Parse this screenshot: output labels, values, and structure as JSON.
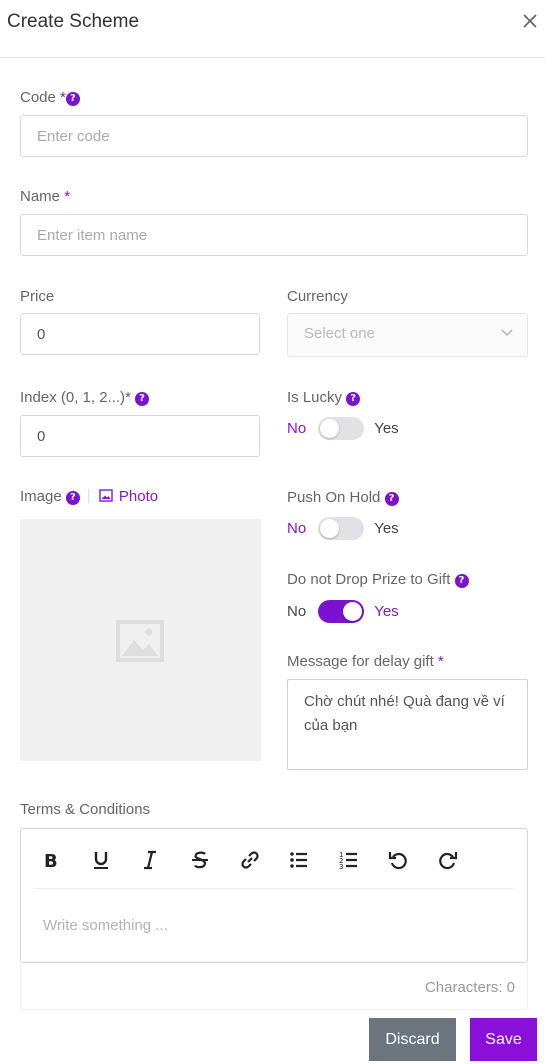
{
  "dialog": {
    "title": "Create Scheme"
  },
  "fields": {
    "code": {
      "label": "Code",
      "required": "*",
      "help": "?",
      "placeholder": "Enter code"
    },
    "name": {
      "label": "Name",
      "required": "*",
      "placeholder": "Enter item name"
    },
    "price": {
      "label": "Price",
      "value": "0"
    },
    "currency": {
      "label": "Currency",
      "placeholder": "Select one"
    },
    "index": {
      "label": "Index (0, 1, 2...)",
      "required": "*",
      "help": "?",
      "value": "0"
    },
    "is_lucky": {
      "label": "Is Lucky",
      "help": "?",
      "no": "No",
      "yes": "Yes",
      "on": false
    },
    "image": {
      "label": "Image",
      "help": "?",
      "photo_label": "Photo"
    },
    "push_on_hold": {
      "label": "Push On Hold",
      "help": "?",
      "no": "No",
      "yes": "Yes",
      "on": false
    },
    "do_not_drop": {
      "label": "Do not Drop Prize to Gift",
      "help": "?",
      "no": "No",
      "yes": "Yes",
      "on": true
    },
    "delay_message": {
      "label": "Message for delay gift",
      "required": "*",
      "value": "Chờ chút nhé! Quà đang về ví của bạn"
    },
    "terms": {
      "label": "Terms & Conditions",
      "placeholder": "Write something ...",
      "characters": "Characters: 0"
    }
  },
  "toolbar": {
    "buttons": [
      "bold-icon",
      "underline-icon",
      "italic-icon",
      "strikethrough-icon",
      "link-icon",
      "bullet-list-icon",
      "numbered-list-icon",
      "undo-icon",
      "redo-icon"
    ]
  },
  "actions": {
    "discard": "Discard",
    "save": "Save"
  },
  "colors": {
    "accent": "#8a0fd9",
    "discard": "#6c757d"
  }
}
